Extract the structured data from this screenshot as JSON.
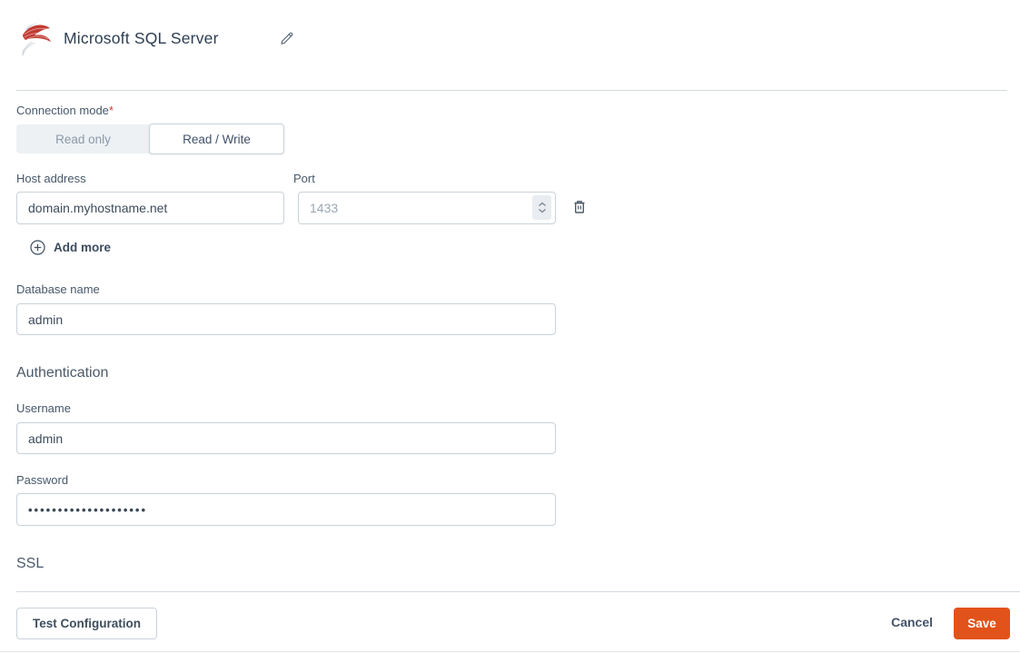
{
  "header": {
    "title": "Microsoft SQL Server",
    "logo_icon": "sql-server-logo",
    "edit_icon": "pencil-icon"
  },
  "connection_mode": {
    "label": "Connection mode",
    "required_marker": "*",
    "options": [
      {
        "label": "Read only",
        "selected": false
      },
      {
        "label": "Read / Write",
        "selected": true
      }
    ]
  },
  "fields": {
    "host": {
      "label": "Host address",
      "value": "domain.myhostname.net"
    },
    "port": {
      "label": "Port",
      "placeholder": "1433",
      "value": "",
      "stepper_icon": "number-stepper-chevrons"
    },
    "database": {
      "label": "Database name",
      "value": "admin"
    },
    "username": {
      "label": "Username",
      "value": "admin"
    },
    "password": {
      "label": "Password",
      "masked_value": "••••••••••••••••••••"
    }
  },
  "actions": {
    "add_more": "Add more",
    "add_icon": "plus-circle-icon",
    "delete_icon": "trash-icon"
  },
  "sections": {
    "authentication": "Authentication",
    "ssl": "SSL"
  },
  "footer": {
    "test_label": "Test Configuration",
    "cancel_label": "Cancel",
    "save_label": "Save"
  },
  "colors": {
    "save_button": "#e2521b",
    "required_marker": "#d63b2f",
    "toggle_background": "#edf1f4",
    "input_border": "#c9d2da"
  }
}
